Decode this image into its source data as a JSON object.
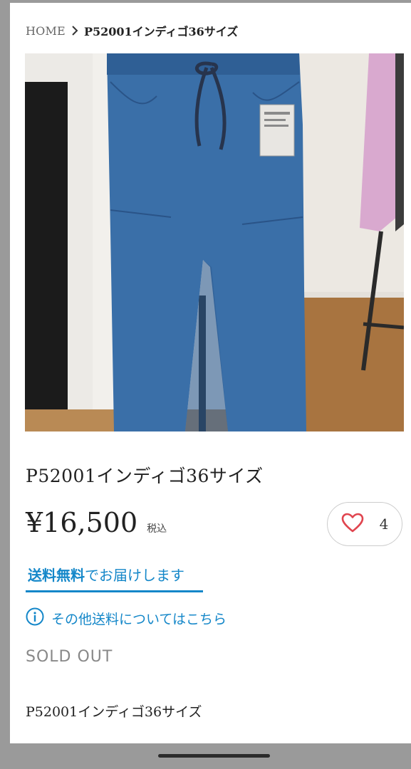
{
  "breadcrumb": {
    "home": "HOME",
    "current": "P52001インディゴ36サイズ"
  },
  "product": {
    "title": "P52001インディゴ36サイズ",
    "price": "¥16,500",
    "tax_label": "税込",
    "like_count": "4",
    "shipping_highlight": "送料無料",
    "shipping_rest": "でお届けします",
    "shipping_info_link": "その他送料についてはこちら",
    "status": "SOLD OUT",
    "description": "P52001インディゴ36サイズ"
  },
  "colors": {
    "accent": "#1487c9",
    "like_heart": "#e0454f",
    "text": "#222222",
    "muted": "#888888"
  },
  "icons": {
    "breadcrumb_separator": "chevron-right-icon",
    "like": "heart-icon",
    "info": "info-circle-icon"
  }
}
